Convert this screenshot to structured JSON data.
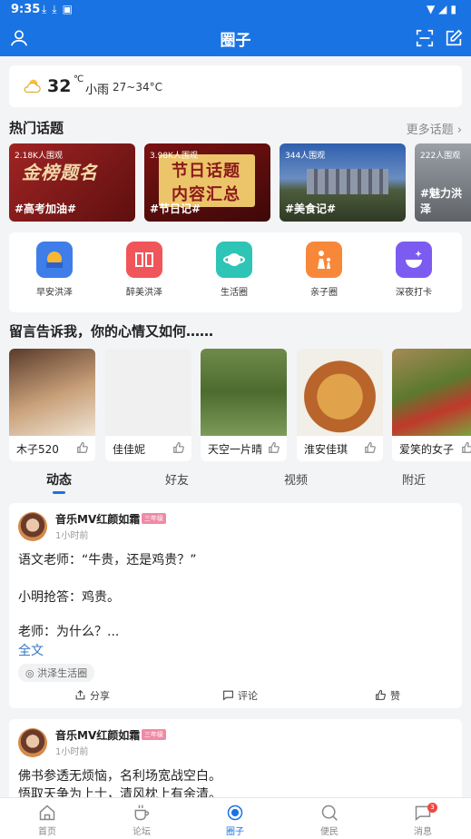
{
  "status_bar": {
    "time": "9:35"
  },
  "header": {
    "title": "圈子"
  },
  "weather": {
    "temperature": "32",
    "unit": "℃",
    "condition": "小雨",
    "range": "27~34°C"
  },
  "hot_topics": {
    "title": "热门话题",
    "more": "更多话题 ›",
    "items": [
      {
        "views": "2.18K人围观",
        "name": "#高考加油#"
      },
      {
        "views": "3.98K人围观",
        "name": "#节日记#"
      },
      {
        "views": "344人围观",
        "name": "#美食记#"
      },
      {
        "views": "222人围观",
        "name": "#魅力洪泽"
      }
    ]
  },
  "shortcuts": [
    {
      "label": "早安洪泽",
      "icon": "sunrise-icon",
      "color": "#3f7de8"
    },
    {
      "label": "醉美洪泽",
      "icon": "book-icon",
      "color": "#f0555a"
    },
    {
      "label": "生活圈",
      "icon": "planet-icon",
      "color": "#2ec4b6"
    },
    {
      "label": "亲子圈",
      "icon": "parent-child-icon",
      "color": "#f7883a"
    },
    {
      "label": "深夜打卡",
      "icon": "smile-star-icon",
      "color": "#7c5cf0"
    }
  ],
  "mood": {
    "title": "留言告诉我，你的心情又如何……",
    "items": [
      {
        "name": "木子520"
      },
      {
        "name": "佳佳妮"
      },
      {
        "name": "天空一片晴"
      },
      {
        "name": "淮安佳琪"
      },
      {
        "name": "爱笑的女子"
      }
    ]
  },
  "tabs": [
    "动态",
    "好友",
    "视频",
    "附近"
  ],
  "posts": [
    {
      "author": "音乐MV红颜如霜",
      "time": "1小时前",
      "lines": [
        "语文老师：“牛贵，还是鸡贵？”",
        "小明抢答：鸡贵。",
        "老师：为什么？..."
      ],
      "more": "全文",
      "tag": "◎ 洪泽生活圈",
      "share": "分享",
      "comment": "评论",
      "like": "赞"
    },
    {
      "author": "音乐MV红颜如霜",
      "time": "1小时前",
      "lines": [
        "佛书参透无烦恼，名利场宽战空白。",
        "悟取天争为上士，清风枕上有余清。"
      ]
    }
  ],
  "bottom_nav": [
    {
      "label": "首页",
      "icon": "home-icon"
    },
    {
      "label": "论坛",
      "icon": "coffee-icon"
    },
    {
      "label": "圈子",
      "icon": "circle-icon",
      "active": true
    },
    {
      "label": "便民",
      "icon": "search-icon"
    },
    {
      "label": "消息",
      "icon": "message-icon",
      "badge": "3"
    }
  ]
}
